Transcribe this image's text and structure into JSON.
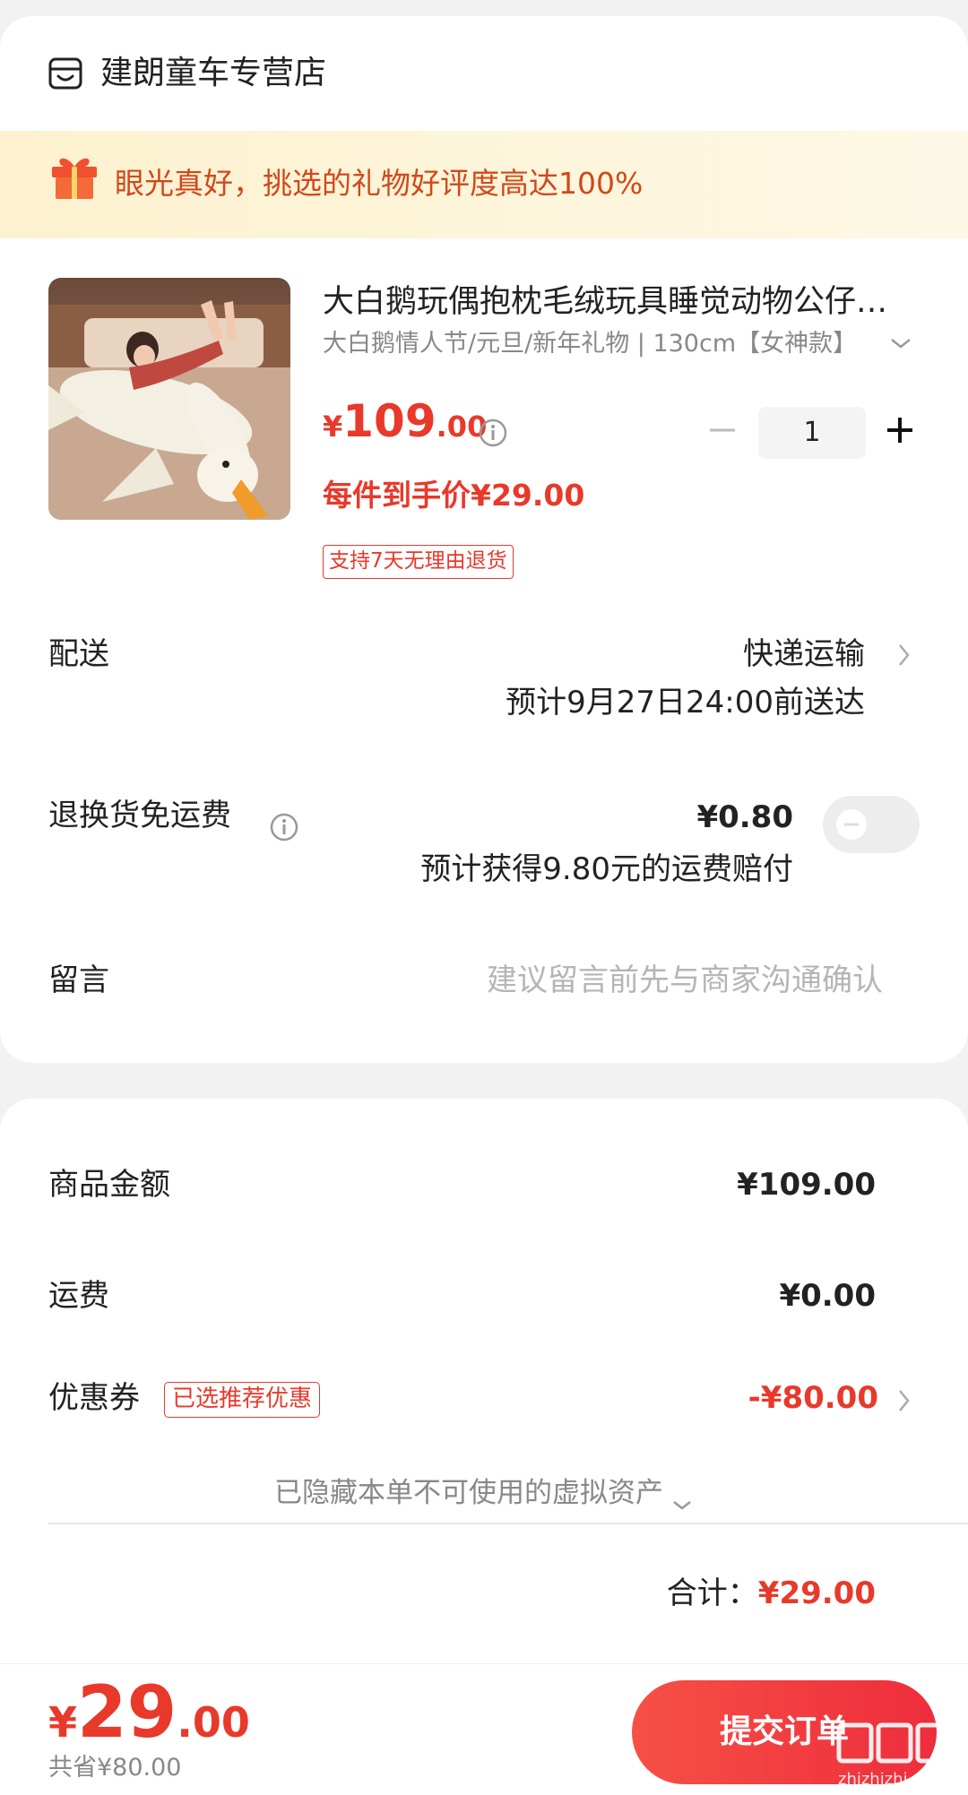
{
  "store": {
    "name": "建朗童车专营店",
    "icon": "store-icon"
  },
  "banner": {
    "text": "眼光真好，挑选的礼物好评度高达100%",
    "icon": "gift-icon"
  },
  "product": {
    "title": "大白鹅玩偶抱枕毛绒玩具睡觉动物公仔女生床上大号娃娃",
    "spec": "大白鹅情人节/元旦/新年礼物 | 130cm【女神款】",
    "price_yen": "¥",
    "price_int": "109",
    "price_dec": ".00",
    "final_price": "每件到手价¥29.00",
    "quantity": "1",
    "return_tag": "支持7天无理由退货"
  },
  "delivery": {
    "label": "配送",
    "method": "快递运输",
    "eta": "预计9月27日24:00前送达"
  },
  "return_fee": {
    "label": "退换货免运费",
    "price": "¥0.80",
    "note": "预计获得9.80元的运费赔付",
    "enabled": false
  },
  "message": {
    "label": "留言",
    "placeholder": "建议留言前先与商家沟通确认"
  },
  "summary": {
    "amount_label": "商品金额",
    "amount_value": "¥109.00",
    "shipping_label": "运费",
    "shipping_value": "¥0.00",
    "coupon_label": "优惠券",
    "coupon_badge": "已选推荐优惠",
    "coupon_value": "-¥80.00",
    "hidden_assets": "已隐藏本单不可使用的虚拟资产",
    "total_label": "合计：",
    "total_value": "¥29.00"
  },
  "bottom": {
    "pay_yen": "¥",
    "pay_int": "29",
    "pay_dec": ".00",
    "saved": "共省¥80.00",
    "submit_label": "提交订单",
    "watermark_text": "zhizhizhi.com"
  },
  "colors": {
    "accent": "#e8392b",
    "banner_text": "#d2481b",
    "submit_start": "#f65046",
    "submit_end": "#ee2d3c"
  }
}
